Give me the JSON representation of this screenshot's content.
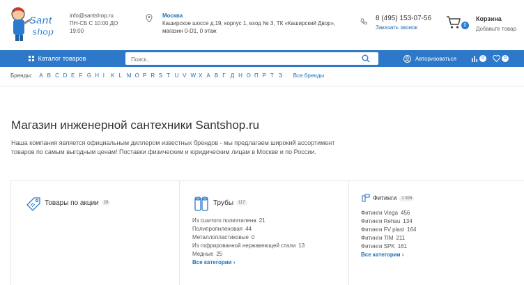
{
  "header": {
    "email": "info@santshop.ru",
    "hours": "ПН-СБ С 10:00 ДО 19:00",
    "city": "Москва",
    "address": "Каширское шоссе д.19, корпус 1, вход № 3, ТК «Каширский Двор», магазин 0-D1, 0 этаж",
    "phone": "8 (495) 153-07-56",
    "callback": "Заказать звонок",
    "cart": {
      "title": "Корзина",
      "subtitle": "Добавьте товар",
      "count": "0"
    },
    "logo_text": "Sant shop"
  },
  "nav": {
    "catalog": "Каталог товаров",
    "search_placeholder": "Поиск...",
    "login": "Авторизоваться",
    "compare_count": "0",
    "favorites_count": "0"
  },
  "brands": {
    "label": "Бренды:",
    "letters": [
      "A",
      "B",
      "C",
      "D",
      "E",
      "F",
      "G",
      "H",
      "I",
      "K",
      "L",
      "M",
      "O",
      "P",
      "R",
      "S",
      "T",
      "U",
      "V",
      "W",
      "X",
      "А",
      "В",
      "Г",
      "Д",
      "Н",
      "О",
      "П",
      "Р",
      "Т",
      "Э"
    ],
    "all": "Все бренды"
  },
  "main": {
    "title": "Магазин инженерной сантехники Santshop.ru",
    "description": "Наша компания является официальным диллером известных брендов - мы предлагаем широкий ассортимент товаров по самым выгодным ценам! Поставки физическим и юридическим лицам в Москве и по России."
  },
  "cards": [
    {
      "title": "Товары по акции",
      "count": "26",
      "icon": "tag-icon",
      "items": [],
      "all": ""
    },
    {
      "title": "Трубы",
      "count": "117",
      "icon": "pipes-icon",
      "items": [
        {
          "label": "Из сшитого полиэтилена",
          "count": "21"
        },
        {
          "label": "Полипропиленовая",
          "count": "44"
        },
        {
          "label": "Металлопластиковые",
          "count": "0"
        },
        {
          "label": "Из гофрированной нержавеющей стали",
          "count": "13"
        },
        {
          "label": "Медные",
          "count": "25"
        }
      ],
      "all": "Все категории ›"
    },
    {
      "title": "Фитинги",
      "count": "1 928",
      "icon": "fittings-icon",
      "items": [
        {
          "label": "Фитинги Viega",
          "count": "456"
        },
        {
          "label": "Фитинги Rehau",
          "count": "134"
        },
        {
          "label": "Фитинги FV plast",
          "count": "164"
        },
        {
          "label": "Фитинги TIM",
          "count": "211"
        },
        {
          "label": "Фитинги SPK",
          "count": "161"
        }
      ],
      "all": "Все категории ›"
    }
  ],
  "colors": {
    "accent": "#2d78c8",
    "link": "#1f6fb5"
  }
}
